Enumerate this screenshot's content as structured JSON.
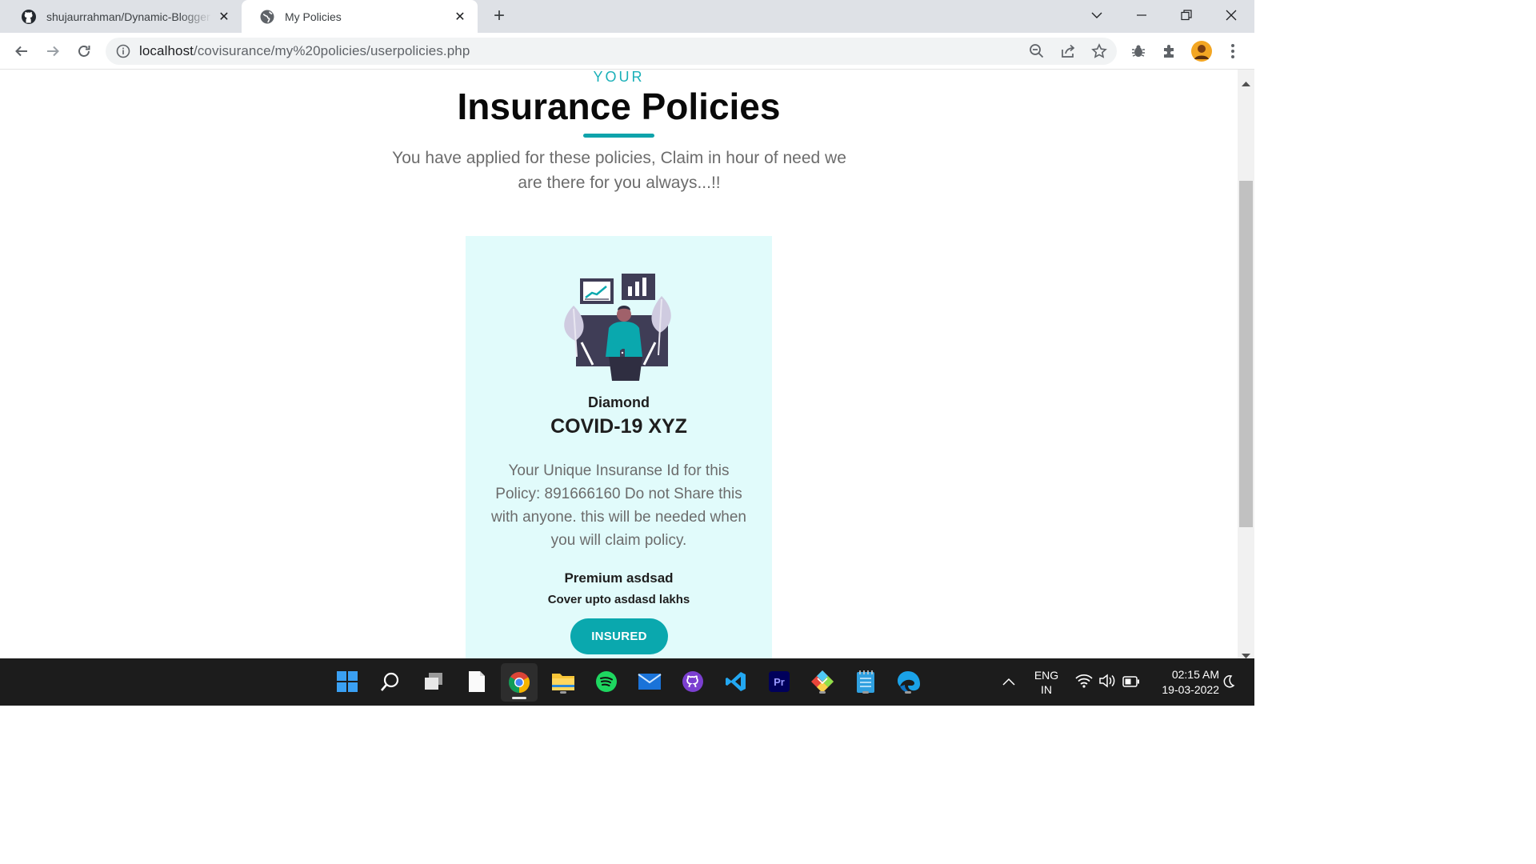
{
  "browser": {
    "tabs": [
      {
        "title": "shujaurrahman/Dynamic-Blogger",
        "favicon": "github-icon",
        "active": false
      },
      {
        "title": "My Policies",
        "favicon": "globe-icon",
        "active": true
      }
    ],
    "address": {
      "host": "localhost",
      "path": "/covisurance/my%20policies/userpolicies.php"
    }
  },
  "page": {
    "kicker": "YOUR",
    "heading": "Insurance Policies",
    "lead": "You have applied for these policies, Claim in hour of need we are there for you always...!!",
    "accent_color": "#0fa3ab"
  },
  "policy_card": {
    "plan": "Diamond",
    "name": "COVID-19 XYZ",
    "description": "Your Unique Insuranse Id for this Policy: 891666160 Do not Share this with anyone. this will be needed when you will claim policy.",
    "premium": "Premium asdsad",
    "cover": "Cover upto asdasd lakhs",
    "status_button": "INSURED",
    "background_color": "#e1fbfb"
  },
  "taskbar": {
    "apps": [
      "windows-start-icon",
      "search-icon",
      "task-view-icon",
      "notepad-file-icon",
      "chrome-icon",
      "file-explorer-icon",
      "spotify-icon",
      "mail-icon",
      "github-desktop-icon",
      "vscode-icon",
      "premiere-pro-icon",
      "git-icon",
      "notepad-icon",
      "edge-icon"
    ],
    "language": "ENG",
    "region": "IN",
    "time": "02:15 AM",
    "date": "19-03-2022"
  }
}
